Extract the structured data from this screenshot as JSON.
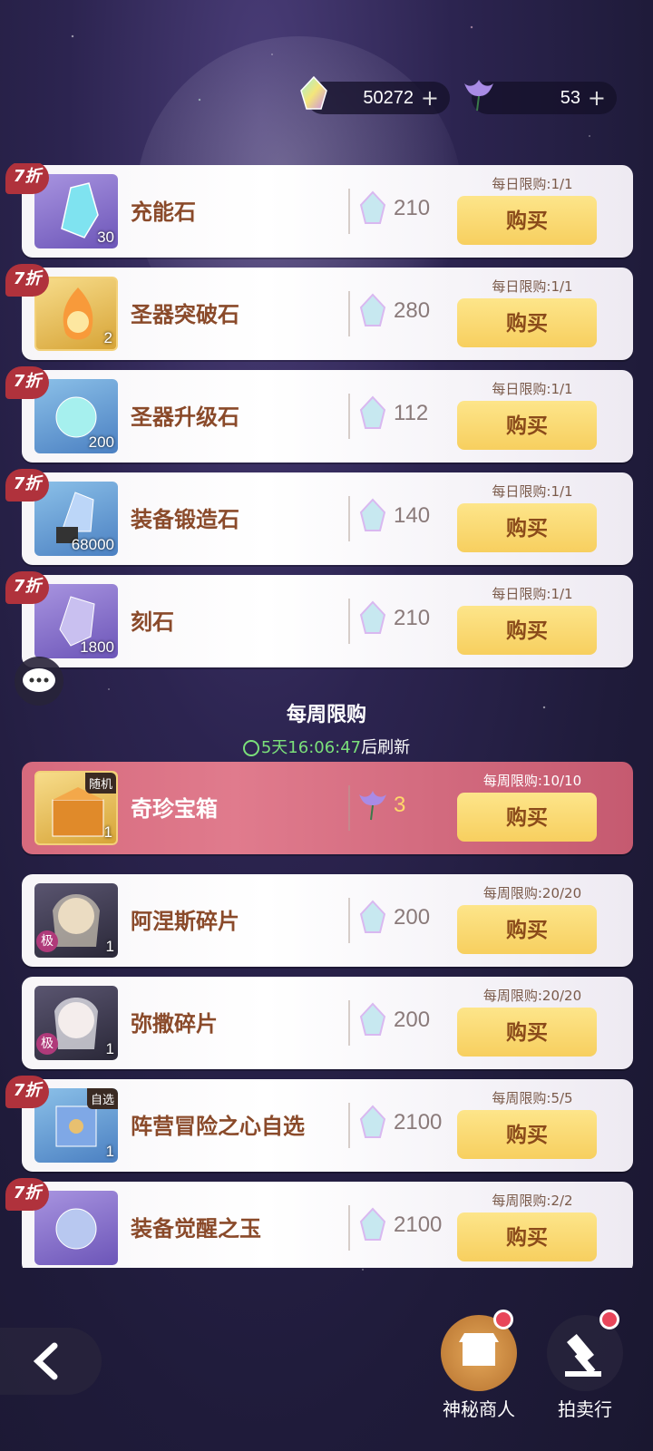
{
  "currency": {
    "gem": {
      "icon": "rainbow-gem-icon",
      "value": "50272",
      "plus": "+"
    },
    "flower": {
      "icon": "purple-flower-icon",
      "value": "53",
      "plus": "+"
    }
  },
  "daily_items": [
    {
      "discount": "7折",
      "name": "充能石",
      "qty": "30",
      "price": "210",
      "limit": "每日限购:1/1",
      "buy": "购买"
    },
    {
      "discount": "7折",
      "name": "圣器突破石",
      "qty": "2",
      "price": "280",
      "limit": "每日限购:1/1",
      "buy": "购买"
    },
    {
      "discount": "7折",
      "name": "圣器升级石",
      "qty": "200",
      "price": "112",
      "limit": "每日限购:1/1",
      "buy": "购买"
    },
    {
      "discount": "7折",
      "name": "装备锻造石",
      "qty": "68000",
      "price": "140",
      "limit": "每日限购:1/1",
      "buy": "购买"
    },
    {
      "discount": "7折",
      "name": "刻石",
      "qty": "1800",
      "price": "210",
      "limit": "每日限购:1/1",
      "buy": "购买"
    }
  ],
  "weekly_section": {
    "title": "每周限购",
    "timer": "5天16:06:47",
    "suffix": "后刷新"
  },
  "weekly_items": [
    {
      "tag": "随机",
      "name": "奇珍宝箱",
      "qty": "1",
      "price": "3",
      "limit": "每周限购:10/10",
      "buy": "购买"
    },
    {
      "tier": "极",
      "name": "阿涅斯碎片",
      "qty": "1",
      "price": "200",
      "limit": "每周限购:20/20",
      "buy": "购买"
    },
    {
      "tier": "极",
      "name": "弥撒碎片",
      "qty": "1",
      "price": "200",
      "limit": "每周限购:20/20",
      "buy": "购买"
    },
    {
      "discount": "7折",
      "tag": "自选",
      "name": "阵营冒险之心自选",
      "qty": "1",
      "price": "2100",
      "limit": "每周限购:5/5",
      "buy": "购买"
    },
    {
      "discount": "7折",
      "name": "装备觉醒之玉",
      "price": "2100",
      "limit": "每周限购:2/2",
      "buy": "购买"
    }
  ],
  "bottom_nav": {
    "merchant": {
      "label": "神秘商人",
      "icon": "shop-icon"
    },
    "auction": {
      "label": "拍卖行",
      "icon": "gavel-icon"
    }
  },
  "colors": {
    "featured_card": "#d66a7d",
    "buy_button": "#f7cf5f",
    "timer": "#7be07a",
    "discount": "#b0323c"
  }
}
